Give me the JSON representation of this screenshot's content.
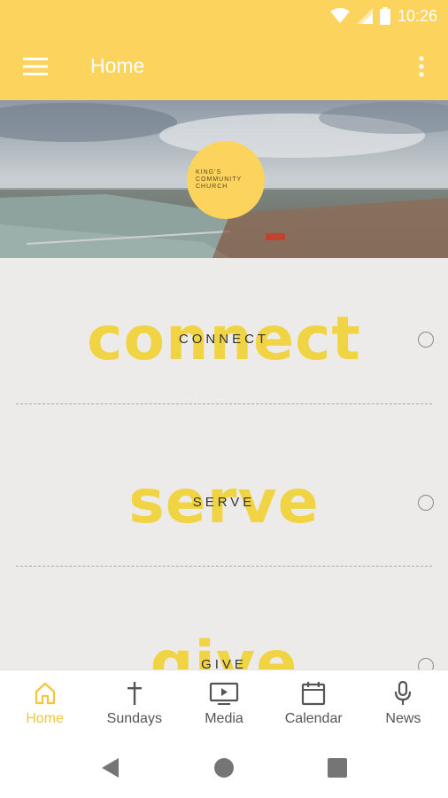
{
  "status_bar": {
    "time": "10:26"
  },
  "app_bar": {
    "title": "Home"
  },
  "hero": {
    "logo_lines": [
      "KING'S",
      "COMMUNITY",
      "CHURCH"
    ]
  },
  "menu": {
    "items": [
      {
        "big": "connect",
        "label": "CONNECT"
      },
      {
        "big": "serve",
        "label": "SERVE"
      },
      {
        "big": "give",
        "label": "GIVE"
      }
    ]
  },
  "bottom_nav": {
    "items": [
      {
        "label": "Home",
        "icon": "home-icon",
        "active": true
      },
      {
        "label": "Sundays",
        "icon": "cross-icon",
        "active": false
      },
      {
        "label": "Media",
        "icon": "media-icon",
        "active": false
      },
      {
        "label": "Calendar",
        "icon": "calendar-icon",
        "active": false
      },
      {
        "label": "News",
        "icon": "microphone-icon",
        "active": false
      }
    ]
  },
  "colors": {
    "accent": "#fcd35d",
    "big_text": "#f1d443",
    "active_nav": "#f3c63a"
  }
}
